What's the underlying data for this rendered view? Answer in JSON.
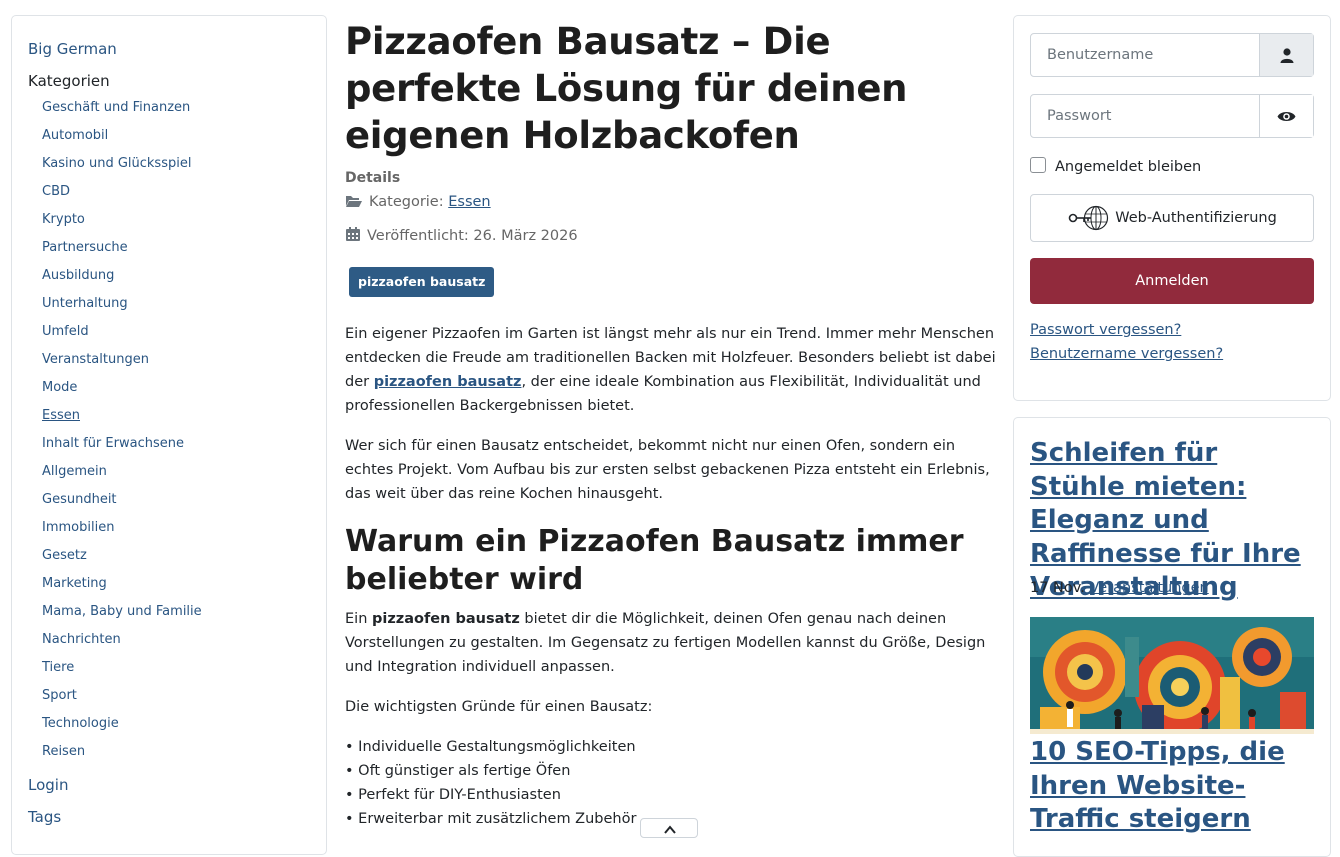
{
  "sidebar": {
    "site_link": "Big German",
    "categories_heading": "Kategorien",
    "categories": [
      "Geschäft und Finanzen",
      "Automobil",
      "Kasino und Glücksspiel",
      "CBD",
      "Krypto",
      "Partnersuche",
      "Ausbildung",
      "Unterhaltung",
      "Umfeld",
      "Veranstaltungen",
      "Mode",
      "Essen",
      "Inhalt für Erwachsene",
      "Allgemein",
      "Gesundheit",
      "Immobilien",
      "Gesetz",
      "Marketing",
      "Mama, Baby und Familie",
      "Nachrichten",
      "Tiere",
      "Sport",
      "Technologie",
      "Reisen"
    ],
    "active_category": "Essen",
    "login_link": "Login",
    "tags_link": "Tags"
  },
  "article": {
    "title": "Pizzaofen Bausatz – Die perfekte Lösung für deinen eigenen Holzbackofen",
    "details_label": "Details",
    "category_label": "Kategorie:",
    "category_value": "Essen",
    "published_label": "Veröffentlicht: 26. März 2026",
    "tag": "pizzaofen bausatz",
    "p1_before": "Ein eigener Pizzaofen im Garten ist längst mehr als nur ein Trend. Immer mehr Menschen entdecken die Freude am traditionellen Backen mit Holzfeuer. Besonders beliebt ist dabei der ",
    "p1_link": "pizzaofen bausatz",
    "p1_after": ", der eine ideale Kombination aus Flexibilität, Individualität und professionellen Backergebnissen bietet.",
    "p2": "Wer sich für einen Bausatz entscheidet, bekommt nicht nur einen Ofen, sondern ein echtes Projekt. Vom Aufbau bis zur ersten selbst gebackenen Pizza entsteht ein Erlebnis, das weit über das reine Kochen hinausgeht.",
    "h2": "Warum ein Pizzaofen Bausatz immer beliebter wird",
    "p3_before": "Ein ",
    "p3_bold": "pizzaofen bausatz",
    "p3_after": " bietet dir die Möglichkeit, deinen Ofen genau nach deinen Vorstellungen zu gestalten. Im Gegensatz zu fertigen Modellen kannst du Größe, Design und Integration individuell anpassen.",
    "p4": "Die wichtigsten Gründe für einen Bausatz:",
    "bullets": [
      "• Individuelle Gestaltungsmöglichkeiten",
      "• Oft günstiger als fertige Öfen",
      "• Perfekt für DIY-Enthusiasten",
      "• Erweiterbar mit zusätzlichem Zubehör"
    ]
  },
  "login": {
    "username_placeholder": "Benutzername",
    "password_placeholder": "Passwort",
    "remember_label": "Angemeldet bleiben",
    "webauthn_label": "Web-Authentifizierung",
    "submit_label": "Anmelden",
    "forgot_password": "Passwort vergessen?",
    "forgot_username": "Benutzername vergessen?"
  },
  "news": {
    "item1_title": "Schleifen für Stühle mieten: Eleganz und Raffinesse für Ihre Veranstaltung",
    "item1_date": "17 Nov.",
    "item1_category": "Veranstaltungen",
    "item2_title": "10 SEO-Tipps, die Ihren Website-Traffic steigern"
  },
  "colors": {
    "link": "#2a5582",
    "login_button": "#912a3c",
    "tag_bg": "#2e5b85"
  }
}
